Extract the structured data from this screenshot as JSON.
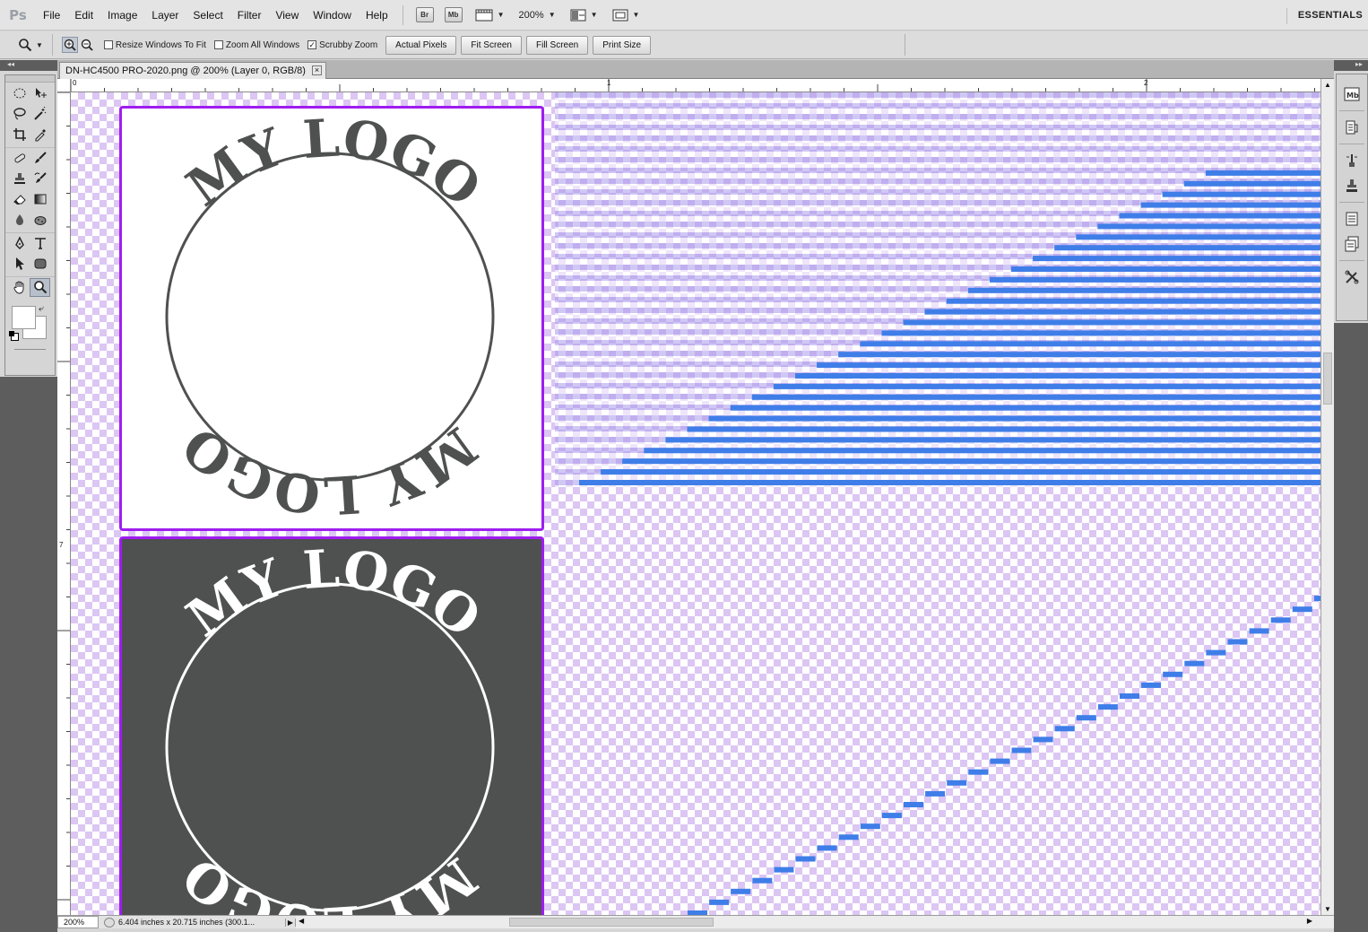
{
  "app": {
    "logo": "Ps",
    "workspace": "ESSENTIALS"
  },
  "menu": [
    "File",
    "Edit",
    "Image",
    "Layer",
    "Select",
    "Filter",
    "View",
    "Window",
    "Help"
  ],
  "appbar": {
    "bridge_label": "Br",
    "minibridge_label": "Mb",
    "zoom_value": "200%"
  },
  "options": {
    "resize_windows": {
      "label": "Resize Windows To Fit",
      "checked": false
    },
    "zoom_all": {
      "label": "Zoom All Windows",
      "checked": false
    },
    "scrubby_zoom": {
      "label": "Scrubby Zoom",
      "checked": true
    },
    "buttons": [
      "Actual Pixels",
      "Fit Screen",
      "Fill Screen",
      "Print Size"
    ]
  },
  "document": {
    "tab_title": "DN-HC4500 PRO-2020.png @ 200% (Layer 0, RGB/8)",
    "close_glyph": "×",
    "logo_text": "MY LOGO"
  },
  "rulers": {
    "top_labels": [
      "0",
      "1",
      "2"
    ],
    "left_labels": [
      "7"
    ]
  },
  "status": {
    "zoom": "200%",
    "doc_info": "6.404 inches x 20.715 inches (300.1..."
  },
  "panel_collapse": "◂◂",
  "panel_expand": "▸▸",
  "colors": {
    "selection_border": "#9f1df0",
    "checker_purple": "#dcc6f3",
    "bar_blue": "#3f7ee8",
    "logo_gray": "#4f5050"
  },
  "dock_icons": [
    "mini-bridge-icon",
    "history-icon",
    "brush-presets-icon",
    "clone-source-icon",
    "notes-icon",
    "layer-comps-icon",
    "tool-presets-icon"
  ]
}
